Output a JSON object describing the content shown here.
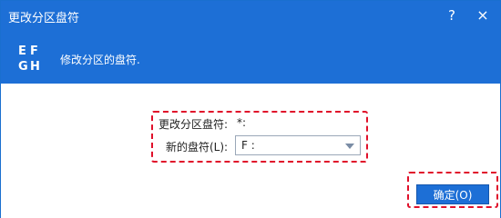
{
  "window": {
    "title": "更改分区盘符",
    "help_label": "?",
    "close_label": "×"
  },
  "header": {
    "logo_letters": [
      "E",
      "F",
      "G",
      "H"
    ],
    "description": "修改分区的盘符."
  },
  "form": {
    "change_label": "更改分区盘符:",
    "current_value": "*:",
    "new_label": "新的盘符(L):",
    "new_value": "F :"
  },
  "buttons": {
    "ok_label": "确定(O)"
  },
  "colors": {
    "title_bar": "#1d6fd6",
    "highlight_dashed": "#e0102a"
  }
}
